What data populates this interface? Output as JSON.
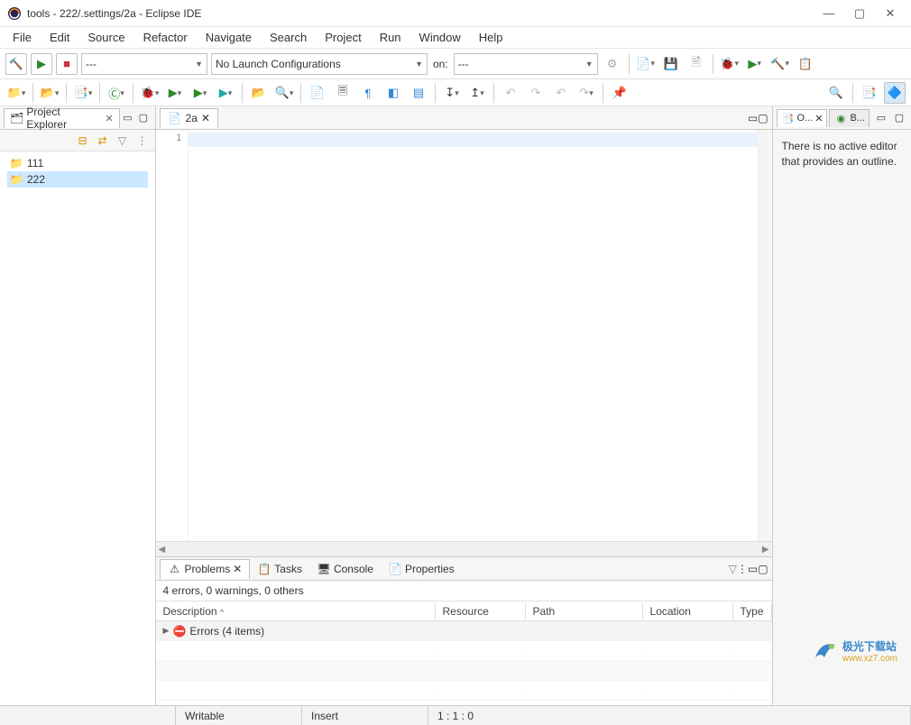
{
  "window": {
    "title": "tools - 222/.settings/2a - Eclipse IDE"
  },
  "menu": [
    "File",
    "Edit",
    "Source",
    "Refactor",
    "Navigate",
    "Search",
    "Project",
    "Run",
    "Window",
    "Help"
  ],
  "toolbar": {
    "launch_combo": "---",
    "config_combo": "No Launch Configurations",
    "on_label": "on:",
    "target_combo": "---"
  },
  "explorer": {
    "title": "Project Explorer",
    "items": [
      {
        "name": "111",
        "selected": false
      },
      {
        "name": "222",
        "selected": true
      }
    ]
  },
  "editor": {
    "tab_label": "2a",
    "line_number": "1"
  },
  "right_panel": {
    "outline_tab_short": "O...",
    "build_tab_short": "B...",
    "outline_message": "There is no active editor that provides an outline."
  },
  "bottom": {
    "tabs": [
      "Problems",
      "Tasks",
      "Console",
      "Properties"
    ],
    "summary": "4 errors, 0 warnings, 0 others",
    "columns": [
      "Description",
      "Resource",
      "Path",
      "Location",
      "Type"
    ],
    "error_row": "Errors (4 items)"
  },
  "status": {
    "writable": "Writable",
    "insert": "Insert",
    "position": "1 : 1 : 0"
  },
  "watermark": {
    "brand": "极光下载站",
    "url": "www.xz7.com"
  }
}
